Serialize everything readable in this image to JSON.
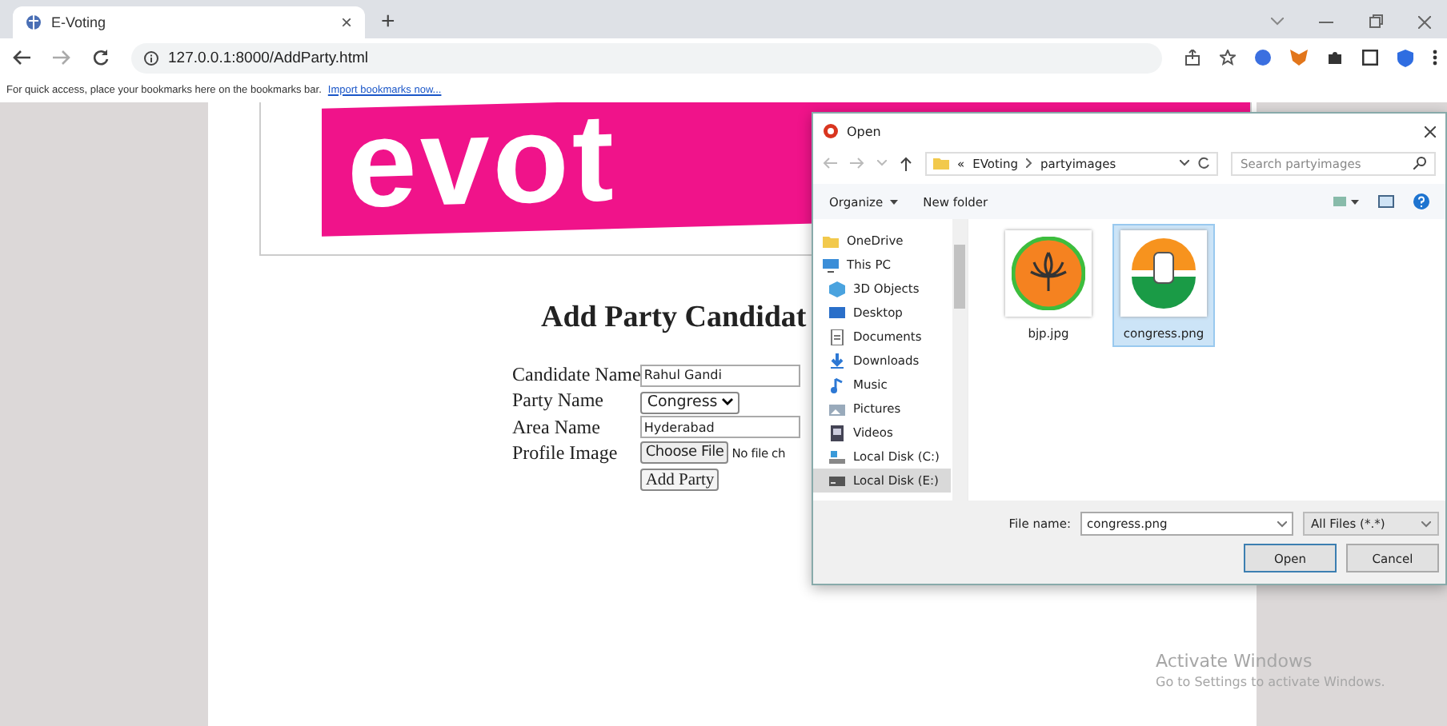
{
  "browser": {
    "tab": {
      "title": "E-Voting",
      "close": "×"
    },
    "new_tab": "+",
    "address": "127.0.0.1:8000/AddParty.html",
    "bookmarks_hint": "For quick access, place your bookmarks here on the bookmarks bar.",
    "bookmarks_link": "Import bookmarks now..."
  },
  "page": {
    "logo_text": "evot",
    "heading": "Add Party Candidat",
    "fields": [
      {
        "kind": "text",
        "label": "Candidate Name",
        "value": "Rahul Gandi"
      },
      {
        "kind": "select",
        "label": "Party Name",
        "value": "Congress"
      },
      {
        "kind": "text",
        "label": "Area Name",
        "value": "Hyderabad"
      },
      {
        "kind": "file",
        "label": "Profile Image",
        "button": "Choose File",
        "value": "No file ch"
      }
    ],
    "submit": "Add Party"
  },
  "dialog": {
    "title": "Open",
    "path_prefix": "«",
    "path": [
      "EVoting",
      "partyimages"
    ],
    "search_placeholder": "Search partyimages",
    "organize": "Organize",
    "new_folder": "New folder",
    "nav": [
      {
        "label": "OneDrive",
        "kind": "folder",
        "selected": false
      },
      {
        "label": "This PC",
        "kind": "pc",
        "selected": false,
        "children": [
          {
            "label": "3D Objects",
            "kind": "cube",
            "selected": false
          },
          {
            "label": "Desktop",
            "kind": "desktop",
            "selected": false
          },
          {
            "label": "Documents",
            "kind": "document",
            "selected": false
          },
          {
            "label": "Downloads",
            "kind": "download",
            "selected": false
          },
          {
            "label": "Music",
            "kind": "music",
            "selected": false
          },
          {
            "label": "Pictures",
            "kind": "pictures",
            "selected": false
          },
          {
            "label": "Videos",
            "kind": "videos",
            "selected": false
          },
          {
            "label": "Local Disk (C:)",
            "kind": "disk",
            "selected": false
          },
          {
            "label": "Local Disk (E:)",
            "kind": "drive",
            "selected": true
          }
        ]
      }
    ],
    "files": [
      {
        "name": "bjp.jpg",
        "kind": "lotus",
        "selected": false
      },
      {
        "name": "congress.png",
        "kind": "hand",
        "selected": true
      }
    ],
    "filename_label": "File name:",
    "filename": "congress.png",
    "filter": "All Files (*.*)",
    "open": "Open",
    "cancel": "Cancel"
  },
  "watermark": {
    "title": "Activate Windows",
    "subtitle": "Go to Settings to activate Windows."
  }
}
